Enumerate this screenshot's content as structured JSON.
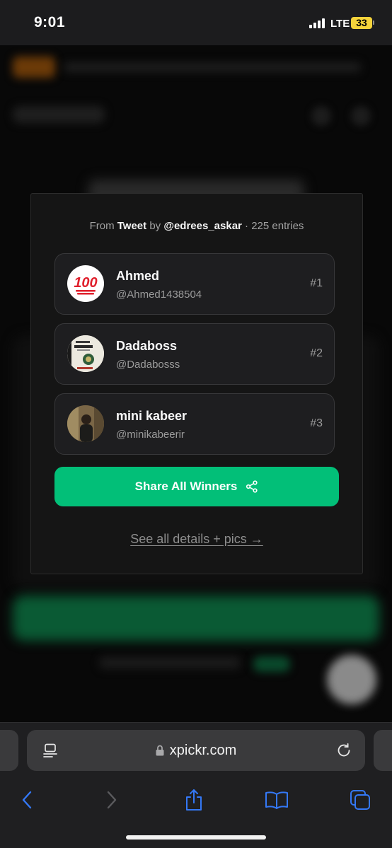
{
  "status_bar": {
    "time": "9:01",
    "network": "LTE",
    "battery": "33"
  },
  "modal": {
    "source": {
      "prefix": "From",
      "source_type": "Tweet",
      "by": "by",
      "author": "@edrees_askar",
      "separator": "·",
      "entries": "225 entries"
    },
    "winners": [
      {
        "name": "Ahmed",
        "handle": "@Ahmed1438504",
        "rank": "#1",
        "avatar_icon": "hundred-points-emoji-avatar"
      },
      {
        "name": "Dadaboss",
        "handle": "@Dadabosss",
        "rank": "#2",
        "avatar_icon": "book-cover-avatar"
      },
      {
        "name": "mini kabeer",
        "handle": "@minikabeerir",
        "rank": "#3",
        "avatar_icon": "person-photo-avatar"
      }
    ],
    "share_button": {
      "label": "Share All Winners",
      "icon": "share-icon"
    },
    "details_link": "See all details + pics →",
    "accent_color": "#02bf78"
  },
  "browser": {
    "url": "xpickr.com",
    "toolbar": [
      "back",
      "forward",
      "share",
      "bookmarks",
      "tabs"
    ],
    "accent_color": "#3478f6"
  }
}
